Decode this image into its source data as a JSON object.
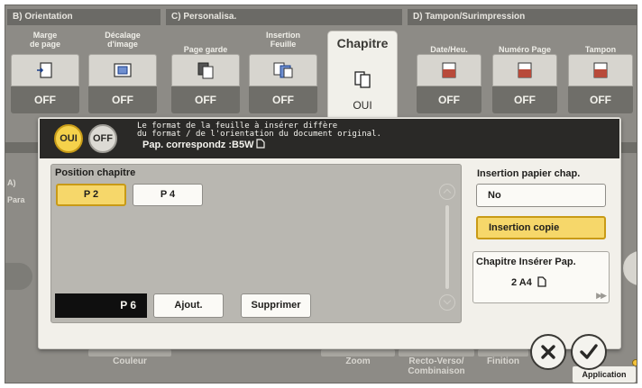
{
  "groups": {
    "b": "B)  Orientation",
    "c": "C)  Personalisa.",
    "d": "D)  Tampon/Surimpression"
  },
  "functions": [
    {
      "label": "Marge\nde page",
      "value": "OFF",
      "icon": "page-margin-icon"
    },
    {
      "label": "Décalage\nd'image",
      "value": "OFF",
      "icon": "image-shift-icon"
    },
    {
      "label": "Page garde",
      "value": "OFF",
      "icon": "cover-sheet-icon"
    },
    {
      "label": "Insertion\nFeuille",
      "value": "OFF",
      "icon": "insert-sheet-icon"
    },
    {
      "label": "Chapitre",
      "value": "OUI",
      "icon": "chapter-icon",
      "active": true
    },
    {
      "label": "Date/Heu.",
      "value": "OFF",
      "icon": "date-time-icon"
    },
    {
      "label": "Numéro Page",
      "value": "OFF",
      "icon": "page-number-icon"
    },
    {
      "label": "Tampon",
      "value": "OFF",
      "icon": "stamp-icon"
    }
  ],
  "background": {
    "left_a": "A)",
    "left_para": "Para",
    "bottom": {
      "couleur": "Couleur",
      "zoom": "Zoom",
      "recto_verso": "Recto-Verso/\nCombinaison",
      "finition": "Finition",
      "application": "Application"
    }
  },
  "popup": {
    "toggle_on": "OUI",
    "toggle_off": "OFF",
    "message_line1": "Le format de la feuille à insérer diffère",
    "message_line2": "du format / de l'orientation du document original.",
    "message_line3": "Pap. correspondz :B5W",
    "position_title": "Position chapitre",
    "chips": [
      "P 2",
      "P 4"
    ],
    "page_input": "P 6",
    "add_label": "Ajout.",
    "delete_label": "Supprimer",
    "insertion_title": "Insertion papier chap.",
    "option_no": "No",
    "option_insert_copy": "Insertion copie",
    "chapter_paper_title": "Chapitre Insérer Pap.",
    "chapter_paper_value": "2  A4"
  },
  "colors": {
    "highlight": "#f6d76a",
    "highlight_border": "#c89a16",
    "panel_dark": "#2a2927",
    "background": "#8d8b86"
  }
}
